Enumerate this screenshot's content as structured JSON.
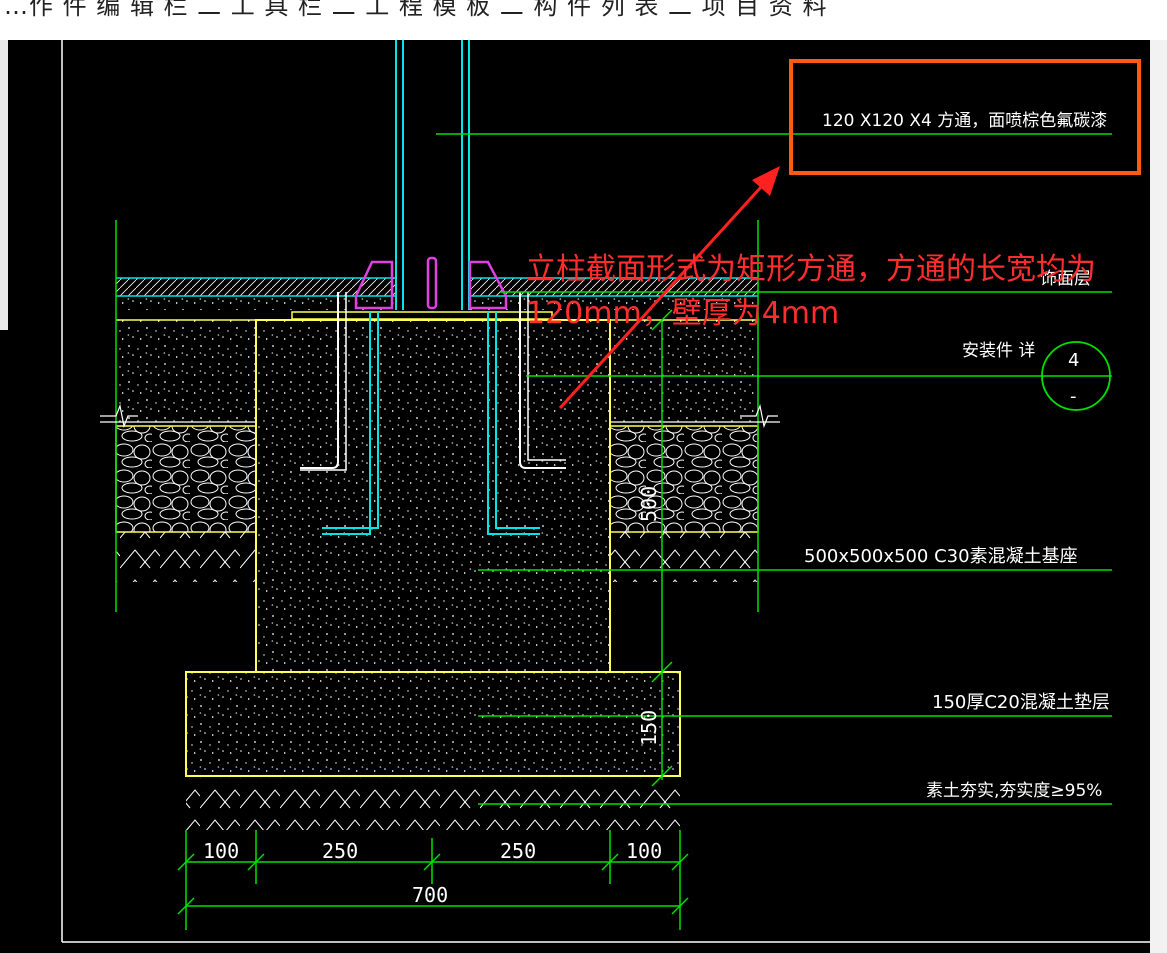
{
  "window": {
    "title_strip": "…作 件 编 辑 栏 二 工 具 栏 二 工 程 模 板 二 构 件 列 表 二 项 目 资 料"
  },
  "colors": {
    "background": "#000000",
    "outline": "#ffff55",
    "dimension": "#00e000",
    "leader": "#00e000",
    "text": "#ffffff",
    "rebar": "#00e5e5",
    "pad": "#e040e0",
    "annotation": "#ff2d2d",
    "highlight_box": "#ff5a14"
  },
  "drawing": {
    "labels": {
      "steel_tube": "120 X120 X4 方通，面喷棕色氟碳漆",
      "surface_layer": "饰面层",
      "embed_detail": "安装件 详",
      "detail_no": "4",
      "detail_sheet": "-",
      "base": "500x500x500  C30素混凝土基座",
      "cushion": "150厚C20混凝土垫层",
      "soil": "素土夯实,夯实度≥95%"
    },
    "dims": {
      "d1": "100",
      "d2": "250",
      "d3": "250",
      "d4": "100",
      "total": "700",
      "height_base": "500",
      "height_cushion": "150"
    }
  },
  "annotation": {
    "text": "立柱截面形式为矩形方通，方通的长宽均为120mm，壁厚为4mm"
  }
}
